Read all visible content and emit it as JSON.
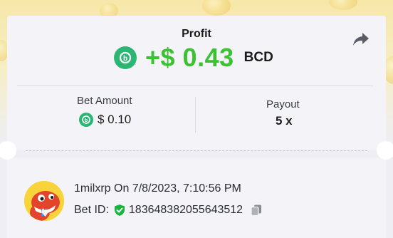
{
  "profit": {
    "label": "Profit",
    "value": "+$ 0.43",
    "currency": "BCD",
    "accent_color": "#3bc131",
    "coin_icon": "bcd-coin-icon"
  },
  "share": {
    "icon": "share-arrow-icon"
  },
  "bet_amount": {
    "label": "Bet Amount",
    "value": "$ 0.10",
    "coin_icon": "bcd-coin-icon"
  },
  "payout": {
    "label": "Payout",
    "value": "5 x"
  },
  "bet": {
    "username": "1milxrp",
    "date_prefix": "On",
    "datetime": "7/8/2023, 7:10:56 PM",
    "id_label": "Bet ID:",
    "id": "183648382055643512",
    "verified_icon": "verified-shield-icon",
    "copy_icon": "copy-icon",
    "avatar_icon": "dinosaur-avatar-icon"
  },
  "colors": {
    "coin": "#2bb673",
    "profit_green": "#3bc131",
    "verified_green": "#17b53f"
  }
}
